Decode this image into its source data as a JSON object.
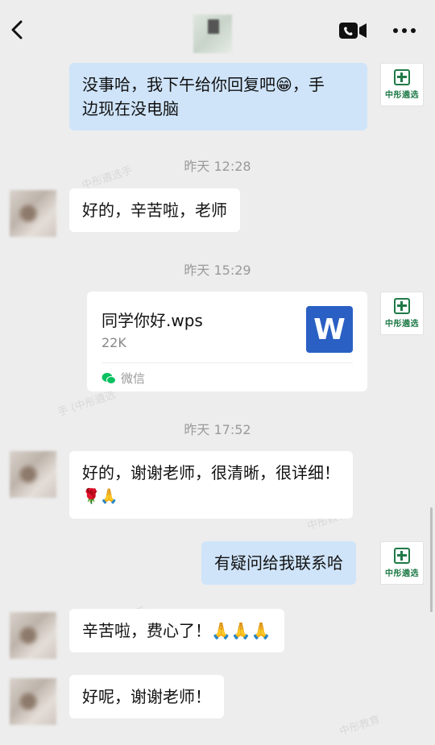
{
  "header": {
    "back_icon": "back-arrow-icon",
    "video_call_icon": "video-call-icon",
    "more_icon": "more-icon"
  },
  "brand": {
    "logo_text": "中彤遴选",
    "logo_color": "#1f7a47"
  },
  "messages": {
    "m1": {
      "text_line1": "没事哈，我下午给你回复吧😁，手",
      "text_line2": "边现在没电脑"
    },
    "t1": "昨天 12:28",
    "m2": {
      "text": "好的，辛苦啦，老师"
    },
    "t2": "昨天 15:29",
    "file": {
      "name": "同学你好.wps",
      "size": "22K",
      "source": "微信",
      "badge": "W"
    },
    "t3": "昨天 17:52",
    "m4": {
      "text_line1": "好的，谢谢老师，很清晰，很详细！",
      "text_line2": "🌹🙏"
    },
    "m5": {
      "text": "有疑问给我联系哈"
    },
    "m6": {
      "text": "辛苦啦，费心了！🙏🙏🙏"
    },
    "m7": {
      "text": "好呢，谢谢老师！"
    }
  },
  "colors": {
    "background": "#ededed",
    "my_bubble": "#cfe4f9",
    "their_bubble": "#ffffff",
    "wps_blue": "#2a5fc4",
    "wechat_green": "#07c160"
  }
}
